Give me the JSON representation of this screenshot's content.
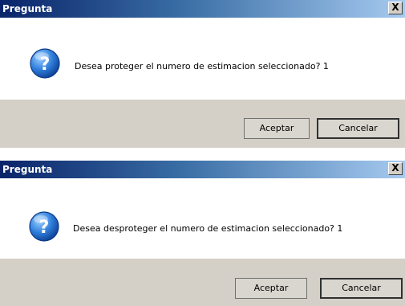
{
  "dialogs": [
    {
      "title": "Pregunta",
      "close_label": "X",
      "icon": "question-icon",
      "message": "Desea proteger el numero de estimacion seleccionado? 1",
      "buttons": {
        "accept": "Aceptar",
        "cancel": "Cancelar"
      }
    },
    {
      "title": "Pregunta",
      "close_label": "X",
      "icon": "question-icon",
      "message": "Desea desproteger el numero de estimacion seleccionado? 1",
      "buttons": {
        "accept": "Aceptar",
        "cancel": "Cancelar"
      }
    }
  ],
  "colors": {
    "titlebar_start": "#0a246a",
    "titlebar_end": "#a6caf0",
    "button_bar": "#d4d0c8",
    "icon_blue": "#1f5fbf"
  }
}
